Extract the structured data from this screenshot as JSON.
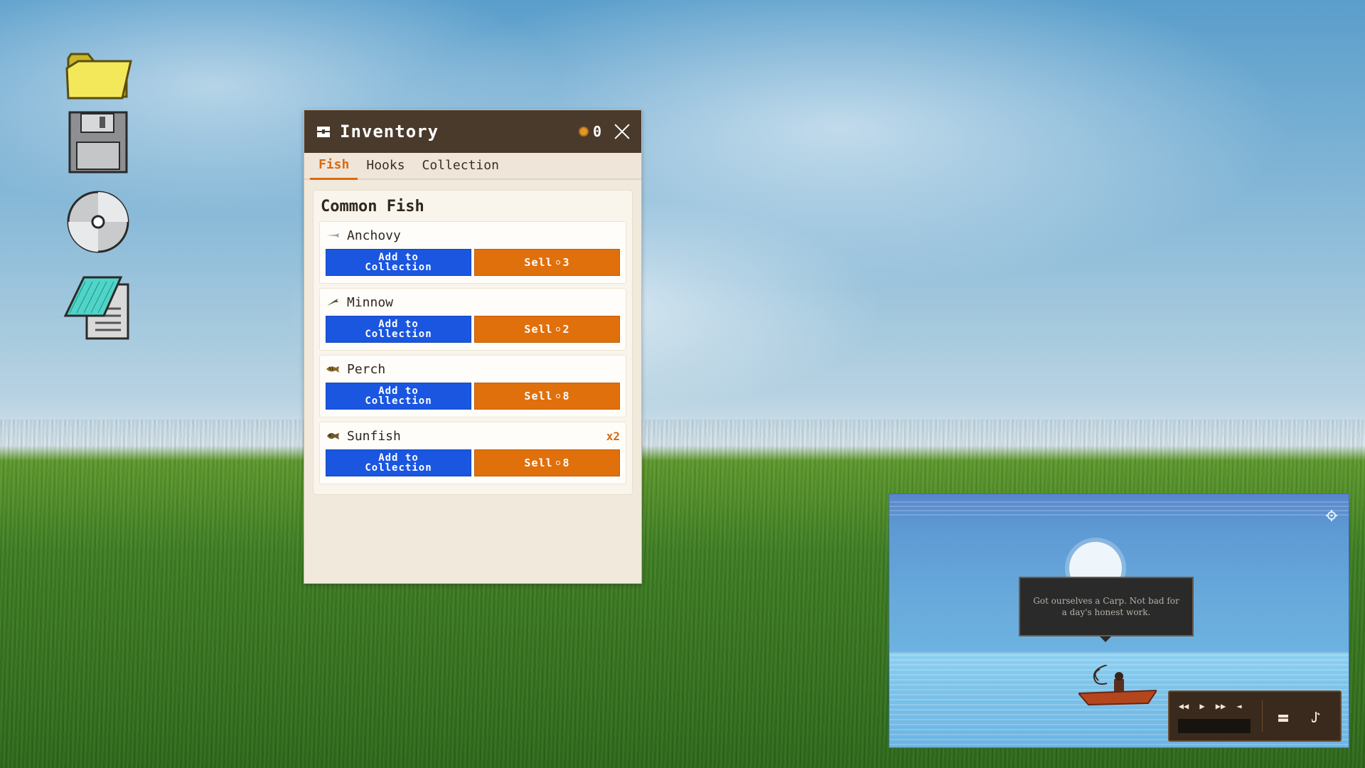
{
  "inventory": {
    "title": "Inventory",
    "coins": "0",
    "tabs": [
      "Fish",
      "Hooks",
      "Collection"
    ],
    "active_tab": "Fish",
    "section_title": "Common Fish",
    "add_label": "Add to\nCollection",
    "fish": [
      {
        "name": "Anchovy",
        "qty": "",
        "sell_label": "Sell",
        "price": "3",
        "icon": "anchovy-icon"
      },
      {
        "name": "Minnow",
        "qty": "",
        "sell_label": "Sell",
        "price": "2",
        "icon": "minnow-icon"
      },
      {
        "name": "Perch",
        "qty": "",
        "sell_label": "Sell",
        "price": "8",
        "icon": "perch-icon"
      },
      {
        "name": "Sunfish",
        "qty": "x2",
        "sell_label": "Sell",
        "price": "8",
        "icon": "sunfish-icon"
      }
    ]
  },
  "game": {
    "dialog": "Got ourselves a Carp. Not bad for a day's honest work.",
    "controls": [
      "rewind-icon",
      "play-icon",
      "fast-forward-icon",
      "volume-icon",
      "inventory-icon",
      "hook-icon"
    ]
  },
  "desktop": {
    "icons": [
      "folder-icon",
      "floppy-disk-icon",
      "cd-icon",
      "notepad-icon"
    ]
  },
  "colors": {
    "titlebar": "#4a3a2c",
    "add_button": "#1a56e0",
    "sell_button": "#e0700c",
    "accent": "#d96a12"
  }
}
